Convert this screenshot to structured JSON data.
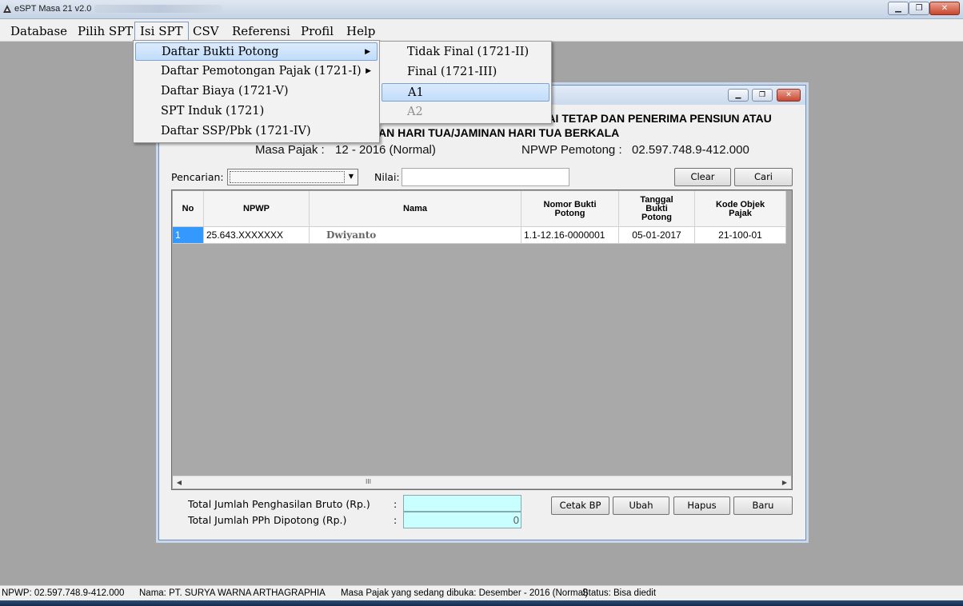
{
  "window": {
    "title": "eSPT Masa 21 v2.0"
  },
  "menubar": {
    "items": [
      {
        "label": "Database"
      },
      {
        "label": "Pilih SPT"
      },
      {
        "label": "Isi SPT"
      },
      {
        "label": "CSV"
      },
      {
        "label": "Referensi"
      },
      {
        "label": "Profil"
      },
      {
        "label": "Help"
      }
    ]
  },
  "isi_spt_menu": {
    "items": [
      {
        "label": "Daftar Bukti Potong",
        "submenu": true,
        "highlighted": true
      },
      {
        "label": "Daftar Pemotongan Pajak (1721-I)",
        "submenu": true
      },
      {
        "label": "Daftar Biaya  (1721-V)"
      },
      {
        "label": "SPT Induk  (1721)"
      },
      {
        "label": "Daftar SSP/Pbk  (1721-IV)"
      }
    ]
  },
  "bukti_potong_submenu": {
    "items": [
      {
        "label": "Tidak Final  (1721-II)"
      },
      {
        "label": "Final  (1721-III)"
      },
      {
        "label": "A1",
        "highlighted": true
      },
      {
        "label": "A2",
        "disabled": true
      }
    ]
  },
  "form": {
    "header_line1": "WAI TETAP DAN PENERIMA PENSIUN ATAU",
    "header_line2": "AN HARI TUA/JAMINAN HARI TUA BERKALA",
    "masa_pajak_label": "Masa Pajak :",
    "masa_pajak_value": "12 - 2016 (Normal)",
    "npwp_pemotong_label": "NPWP Pemotong :",
    "npwp_pemotong_value": "02.597.748.9-412.000",
    "pencarian_label": "Pencarian:",
    "nilai_label": "Nilai:",
    "clear_label": "Clear",
    "cari_label": "Cari",
    "grid": {
      "columns": [
        "No",
        "NPWP",
        "Nama",
        "Nomor Bukti Potong",
        "Tanggal Bukti Potong",
        "Kode Objek Pajak"
      ],
      "rows": [
        {
          "no": "1",
          "npwp": "25.643.XXXXXXX",
          "nama": "Dwiyanto",
          "nomor": "1.1-12.16-0000001",
          "tanggal": "05-01-2017",
          "kode": "21-100-01"
        }
      ],
      "scroll_thumb": "III"
    },
    "total_bruto_label": "Total Jumlah Penghasilan Bruto (Rp.)",
    "total_pph_label": "Total Jumlah PPh Dipotong (Rp.)",
    "colon": ":",
    "total_bruto_value": "",
    "total_pph_value": "0",
    "buttons": {
      "cetak": "Cetak BP",
      "ubah": "Ubah",
      "hapus": "Hapus",
      "baru": "Baru"
    }
  },
  "statusbar": {
    "npwp": "NPWP: 02.597.748.9-412.000",
    "nama": "Nama: PT. SURYA WARNA ARTHAGRAPHIA",
    "masa": "Masa Pajak yang sedang dibuka: Desember - 2016 (Normal)",
    "status": "Status: Bisa diedit"
  },
  "colors": {
    "highlight": "#c1dcfa",
    "selection": "#3399ff",
    "total_box": "#c9ffff",
    "desktop": "#a4a4a4"
  }
}
